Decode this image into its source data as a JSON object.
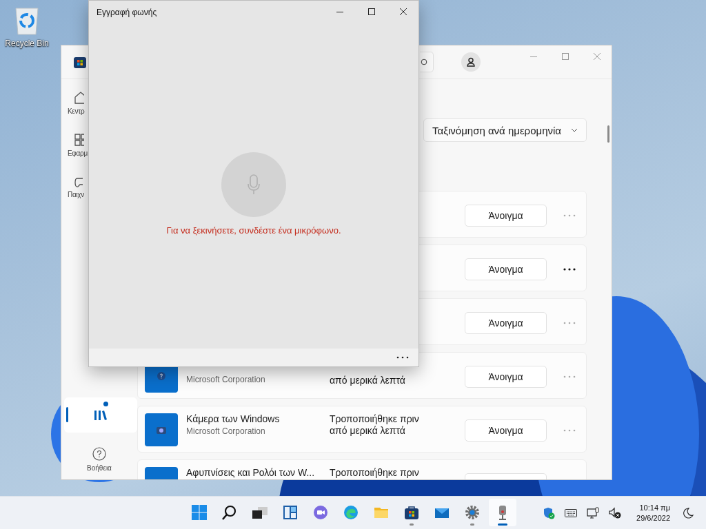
{
  "desktop": {
    "icons": [
      {
        "label": "Recycle Bin",
        "kind": "recycle-bin"
      }
    ]
  },
  "store_window": {
    "sidebar": {
      "items": [
        {
          "kind": "home",
          "label": "Κεντρ",
          "selected": false,
          "badge": false
        },
        {
          "kind": "apps",
          "label": "Εφαρμ",
          "selected": false,
          "badge": false
        },
        {
          "kind": "games",
          "label": "Παιχν",
          "selected": false,
          "badge": false
        },
        {
          "kind": "library",
          "selected": true,
          "badge": true
        },
        {
          "kind": "help",
          "label": "Βοήθεια",
          "selected": false,
          "badge": false
        }
      ]
    },
    "sort": {
      "label": "Ταξινόμηση ανά ημερομηνία"
    },
    "apps": [
      {
        "button": "Άνοιγμα",
        "menu_highlighted": false
      },
      {
        "button": "Άνοιγμα",
        "menu_highlighted": true
      },
      {
        "button": "Άνοιγμα",
        "menu_highlighted": false
      },
      {
        "kind": "help",
        "publisher": "Microsoft Corporation",
        "modified_2": "από μερικά λεπτά",
        "button": "Άνοιγμα",
        "menu_highlighted": false
      },
      {
        "kind": "camera",
        "title": "Κάμερα των Windows",
        "publisher": "Microsoft Corporation",
        "modified": "Τροποποιήθηκε πριν",
        "modified_2": "από μερικά λεπτά",
        "button": "Άνοιγμα",
        "menu_highlighted": false
      },
      {
        "kind": "clock",
        "title": "Αφυπνίσεις και Ρολόι των W...",
        "modified": "Τροποποιήθηκε πριν"
      }
    ]
  },
  "voice_window": {
    "title": "Εγγραφή φωνής",
    "message": "Για να ξεκινήσετε, συνδέστε ένα μικρόφωνο."
  },
  "taskbar": {
    "apps": [
      {
        "kind": "start",
        "running": false,
        "active": false
      },
      {
        "kind": "search",
        "running": false,
        "active": false
      },
      {
        "kind": "task-view",
        "running": false,
        "active": false
      },
      {
        "kind": "widgets",
        "running": false,
        "active": false
      },
      {
        "kind": "chat",
        "running": false,
        "active": false
      },
      {
        "kind": "edge",
        "running": false,
        "active": false
      },
      {
        "kind": "explorer",
        "running": false,
        "active": false
      },
      {
        "kind": "store",
        "running": true,
        "active": false
      },
      {
        "kind": "mail",
        "running": false,
        "active": false
      },
      {
        "kind": "settings",
        "running": true,
        "active": false
      },
      {
        "kind": "recorder",
        "running": true,
        "active": true
      }
    ],
    "tray": [
      {
        "kind": "security"
      },
      {
        "kind": "keyboard"
      },
      {
        "kind": "network"
      },
      {
        "kind": "volume-muted"
      }
    ],
    "time": "10:14 πμ",
    "date": "29/6/2022"
  }
}
